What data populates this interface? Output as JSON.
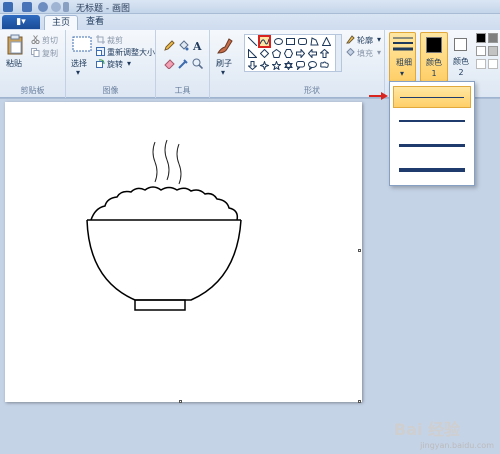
{
  "titlebar": {
    "title": "无标题 - 画图"
  },
  "tabs": {
    "file_button": "▮▾",
    "home": "主页",
    "view": "查看"
  },
  "ribbon": {
    "clipboard": {
      "paste": "粘贴",
      "cut": "剪切",
      "copy": "复制",
      "group": "剪贴板"
    },
    "image": {
      "select": "选择",
      "crop": "裁剪",
      "resize": "重新调整大小",
      "rotate": "旋转",
      "group": "图像"
    },
    "tools": {
      "group": "工具"
    },
    "brushes": {
      "label": "刷子"
    },
    "shapes": {
      "outline": "轮廓",
      "fill": "填充",
      "group": "形状"
    },
    "size": {
      "label": "粗细"
    },
    "color1": {
      "label": "颜色 1"
    },
    "color2": {
      "label": "颜色 2"
    }
  },
  "colors": {
    "accent": "#ffcf68",
    "arrow": "#d9231f",
    "color1": "#000000",
    "color2": "#ffffff"
  },
  "dropdown": {
    "selected_index": 0
  },
  "watermark": {
    "text": "Bai 经验",
    "url": "jingyan.baidu.com"
  }
}
